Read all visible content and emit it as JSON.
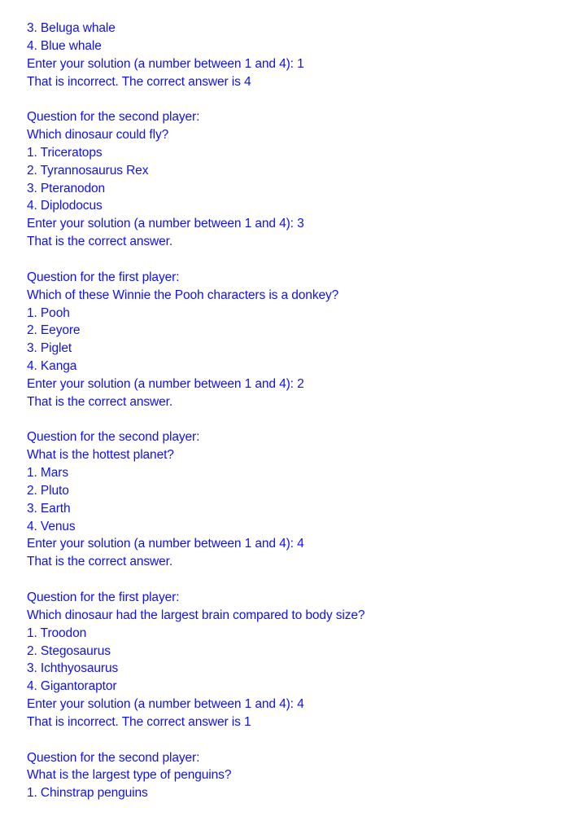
{
  "text_color": "#1010f0",
  "blocks": [
    {
      "kind": "partial",
      "options": [
        "3. Beluga whale",
        "4. Blue whale"
      ],
      "prompt": "Enter your solution (a number between 1 and 4): 1",
      "result": "That is incorrect. The correct answer is 4"
    },
    {
      "header": "Question for the second player:",
      "question": "Which dinosaur could fly?",
      "options": [
        "1. Triceratops",
        "2. Tyrannosaurus Rex",
        "3. Pteranodon",
        "4. Diplodocus"
      ],
      "prompt": "Enter your solution (a number between 1 and 4): 3",
      "result": "That is the correct answer."
    },
    {
      "header": "Question for the first player:",
      "question": "Which of these Winnie the Pooh characters is a donkey?",
      "options": [
        "1. Pooh",
        "2. Eeyore",
        "3. Piglet",
        "4. Kanga"
      ],
      "prompt": "Enter your solution (a number between 1 and 4): 2",
      "result": "That is the correct answer."
    },
    {
      "header": "Question for the second player:",
      "question": "What is the hottest planet?",
      "options": [
        "1. Mars",
        "2. Pluto",
        "3. Earth",
        "4. Venus"
      ],
      "prompt": "Enter your solution (a number between 1 and 4): 4",
      "result": "That is the correct answer."
    },
    {
      "header": "Question for the first player:",
      "question": "Which dinosaur had the largest brain compared to body size?",
      "options": [
        "1. Troodon",
        "2. Stegosaurus",
        "3. Ichthyosaurus",
        "4. Gigantoraptor"
      ],
      "prompt": "Enter your solution (a number between 1 and 4): 4",
      "result": "That is incorrect. The correct answer is 1"
    },
    {
      "header": "Question for the second player:",
      "question": "What is the largest type of penguins?",
      "options": [
        "1. Chinstrap penguins"
      ]
    }
  ]
}
